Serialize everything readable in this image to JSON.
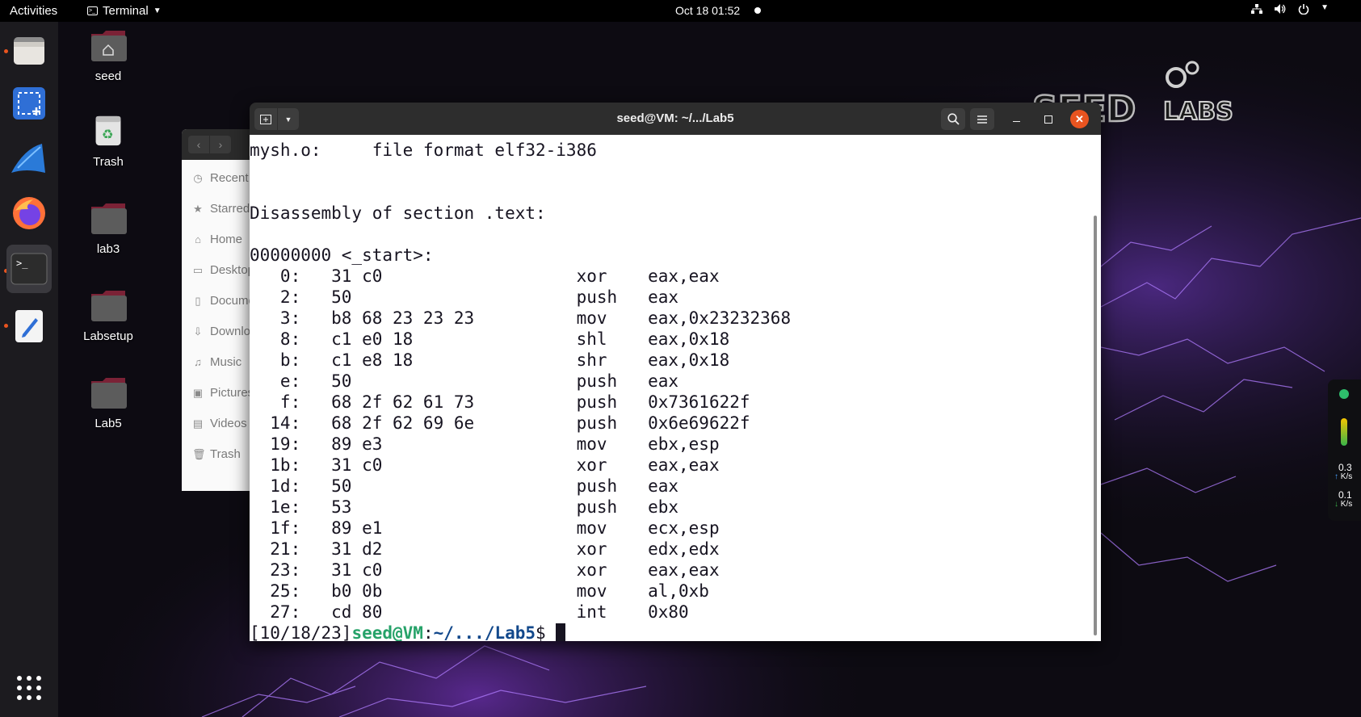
{
  "topbar": {
    "activities": "Activities",
    "app_menu": "Terminal",
    "clock": "Oct 18  01:52"
  },
  "dock": {
    "items": [
      "files",
      "screenshot",
      "wireshark",
      "firefox",
      "terminal",
      "text-editor",
      "show-apps"
    ]
  },
  "desktop": {
    "icons": [
      {
        "label": "seed"
      },
      {
        "label": "Trash"
      },
      {
        "label": "lab3"
      },
      {
        "label": "Labsetup"
      },
      {
        "label": "Lab5"
      }
    ],
    "logo_text": "SEED LABS"
  },
  "files_window": {
    "sidebar": [
      "Recent",
      "Starred",
      "Home",
      "Desktop",
      "Documents",
      "Downloads",
      "Music",
      "Pictures",
      "Videos",
      "Trash"
    ]
  },
  "terminal": {
    "title": "seed@VM: ~/.../Lab5",
    "lines": [
      "mysh.o:     file format elf32-i386",
      "",
      "",
      "Disassembly of section .text:",
      "",
      "00000000 <_start>:",
      "   0:\t31 c0                \txor    eax,eax",
      "   2:\t50                   \tpush   eax",
      "   3:\tb8 68 23 23 23       \tmov    eax,0x23232368",
      "   8:\tc1 e0 18             \tshl    eax,0x18",
      "   b:\tc1 e8 18             \tshr    eax,0x18",
      "   e:\t50                   \tpush   eax",
      "   f:\t68 2f 62 61 73       \tpush   0x7361622f",
      "  14:\t68 2f 62 69 6e       \tpush   0x6e69622f",
      "  19:\t89 e3                \tmov    ebx,esp",
      "  1b:\t31 c0                \txor    eax,eax",
      "  1d:\t50                   \tpush   eax",
      "  1e:\t53                   \tpush   ebx",
      "  1f:\t89 e1                \tmov    ecx,esp",
      "  21:\t31 d2                \txor    edx,edx",
      "  23:\t31 c0                \txor    eax,eax",
      "  25:\tb0 0b                \tmov    al,0xb",
      "  27:\tcd 80                \tint    0x80"
    ],
    "prompt": {
      "date": "[10/18/23]",
      "host": "seed@VM",
      "sep": ":",
      "path": "~/.../Lab5",
      "symbol": "$ "
    }
  },
  "net_widget": {
    "up": "0.3",
    "up_unit": "K/s",
    "down": "0.1",
    "down_unit": "K/s"
  },
  "colors": {
    "prompt_host": "#26a269",
    "prompt_path": "#12488b",
    "close_button": "#e95420"
  }
}
